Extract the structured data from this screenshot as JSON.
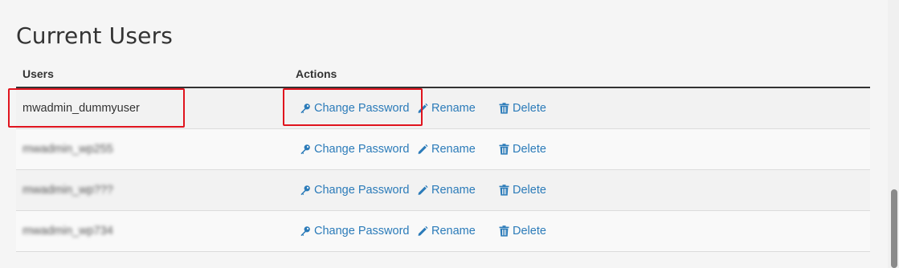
{
  "page": {
    "title": "Current Users"
  },
  "table": {
    "headers": {
      "users": "Users",
      "actions": "Actions"
    },
    "rows": [
      {
        "username": "mwadmin_dummyuser",
        "blurred": false
      },
      {
        "username": "mwadmin_wp255",
        "blurred": true
      },
      {
        "username": "mwadmin_wp???",
        "blurred": true
      },
      {
        "username": "mwadmin_wp734",
        "blurred": true
      }
    ],
    "actions": {
      "change_password": "Change Password",
      "rename": "Rename",
      "delete": "Delete"
    }
  },
  "icons": {
    "change_password": "key-icon",
    "rename": "pencil-icon",
    "delete": "trash-icon"
  },
  "colors": {
    "link": "#2b7bb9",
    "highlight": "#e0141e",
    "header_rule": "#333333"
  }
}
